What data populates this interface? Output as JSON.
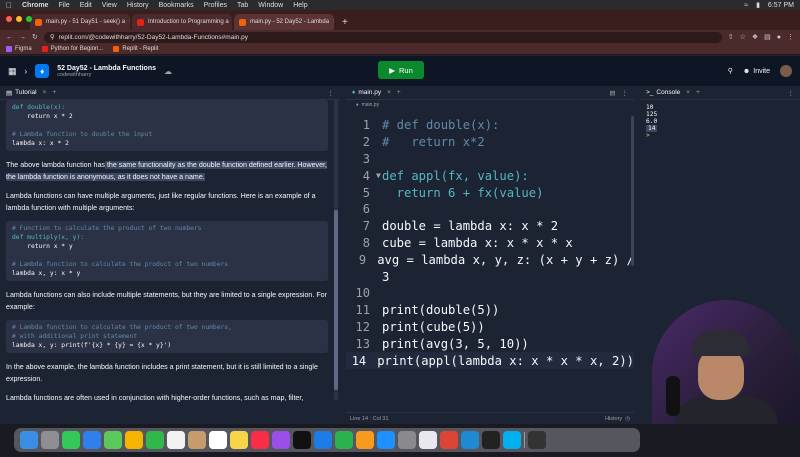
{
  "menubar": {
    "items": [
      "Chrome",
      "File",
      "Edit",
      "View",
      "History",
      "Bookmarks",
      "Profiles",
      "Tab",
      "Window",
      "Help"
    ],
    "clock": "6:57 PM"
  },
  "browser": {
    "tabs": [
      {
        "label": "main.py - 51 Day51 - seek() a",
        "close": "×"
      },
      {
        "label": "Introduction to Programming a",
        "close": "×"
      },
      {
        "label": "main.py - 52 Day52 - Lambda",
        "close": "×"
      }
    ],
    "new_tab": "+",
    "url": "replit.com/@codewithharry/52-Day52-Lambda-Functions#main.py",
    "bookmarks": [
      "Figma",
      "Python for Beginn...",
      "Replit - Replit"
    ]
  },
  "app": {
    "project_title": "52 Day52 - Lambda Functions",
    "username": "codewithharry",
    "run_label": "Run",
    "invite_label": "Invite"
  },
  "tutorial": {
    "tab_label": "Tutorial",
    "code1": [
      "def double(x):",
      "    return x * 2",
      "",
      "# Lambda function to double the input",
      "lambda x: x * 2"
    ],
    "para1_plain": "The above lambda function has",
    "para1_hl": " the same functionality as the double function defined earlier. However, the lambda function is anonymous, as it does not have a name.",
    "para2": "Lambda functions can have multiple arguments, just like regular functions. Here is an example of a lambda function with multiple arguments:",
    "code2": [
      "# Function to calculate the product of two numbers",
      "def multiply(x, y):",
      "    return x * y",
      "",
      "# Lambda function to calculate the product of two numbers",
      "lambda x, y: x * y"
    ],
    "para3": "Lambda functions can also include multiple statements, but they are limited to a single expression. For example:",
    "code3": [
      "# Lambda function to calculate the product of two numbers,",
      "# with additional print statement",
      "lambda x, y: print(f'{x} * {y} = {x * y}')"
    ],
    "para4": "In the above example, the lambda function includes a print statement, but it is still limited to a single expression.",
    "para5": "Lambda functions are often used in conjunction with higher-order functions, such as map, filter,"
  },
  "editor": {
    "tab_label": "main.py",
    "breadcrumb": "main.py",
    "lines": [
      {
        "n": "1",
        "text": "# def double(x):"
      },
      {
        "n": "2",
        "text": "#   return x*2"
      },
      {
        "n": "3",
        "text": ""
      },
      {
        "n": "4",
        "text": "def appl(fx, value):"
      },
      {
        "n": "5",
        "text": "  return 6 + fx(value)"
      },
      {
        "n": "6",
        "text": ""
      },
      {
        "n": "7",
        "text": "double = lambda x: x * 2"
      },
      {
        "n": "8",
        "text": "cube = lambda x: x * x * x"
      },
      {
        "n": "9",
        "text": "avg = lambda x, y, z: (x + y + z) /"
      },
      {
        "n": "",
        "text": "3"
      },
      {
        "n": "10",
        "text": ""
      },
      {
        "n": "11",
        "text": "print(double(5))"
      },
      {
        "n": "12",
        "text": "print(cube(5))"
      },
      {
        "n": "13",
        "text": "print(avg(3, 5, 10))"
      },
      {
        "n": "14",
        "text": "print(appl(lambda x: x * x * x, 2))"
      }
    ],
    "status": "Line 14 : Col 31",
    "history_label": "History"
  },
  "console": {
    "tab_label": "Console",
    "output": [
      "10",
      "125",
      "6.0",
      "14"
    ],
    "prompt": "> "
  },
  "colors": {
    "run_green": "#0a8a2c",
    "replit_blue": "#0079f2",
    "bg": "#1c2333"
  }
}
